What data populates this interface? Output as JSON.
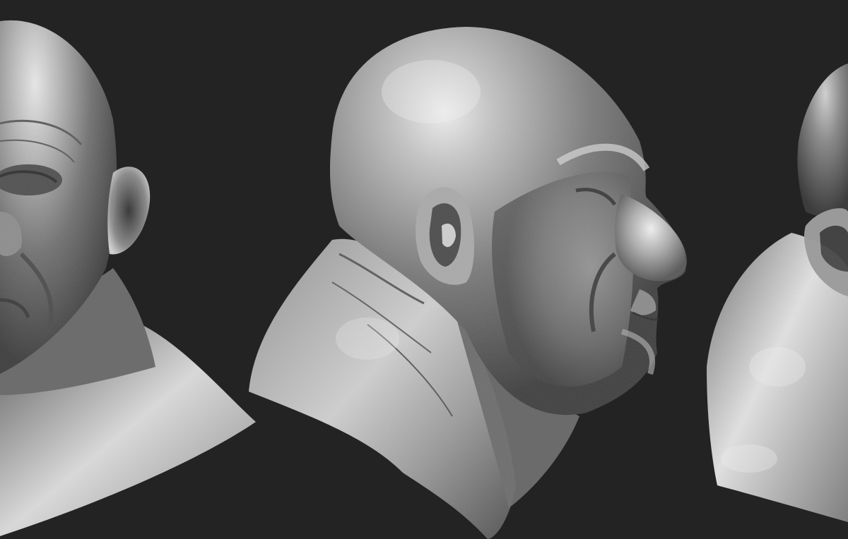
{
  "scene": {
    "background_color": "#232323",
    "material_colors": {
      "shadow": "#2a2a2a",
      "dark": "#4a4a4a",
      "mid": "#7d7d7d",
      "light": "#b9b9b9",
      "highlight": "#ececec"
    },
    "views": [
      {
        "id": "front-left",
        "label": ""
      },
      {
        "id": "side-profile",
        "label": ""
      },
      {
        "id": "back-right",
        "label": ""
      }
    ]
  }
}
